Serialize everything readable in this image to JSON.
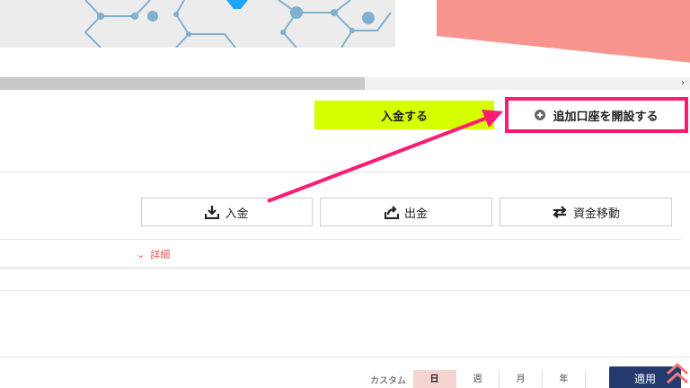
{
  "scrollbar": {
    "arrow": "›"
  },
  "actions": {
    "deposit_label": "入金する",
    "add_account_label": "追加口座を開設する"
  },
  "account_buttons": {
    "deposit": "入金",
    "withdraw": "出金",
    "transfer": "資金移動"
  },
  "detail": {
    "chevron": "⌄",
    "label": "詳細"
  },
  "filters": {
    "custom": "カスタム",
    "tabs": [
      "日",
      "週",
      "月",
      "年"
    ],
    "active": "日",
    "apply": "適用"
  },
  "colors": {
    "deposit_button": "#d6ff00",
    "highlight": "#ff1a73",
    "apply_button": "#243a6e",
    "active_tab": "#f6d3d3",
    "detail_text": "#e05a5a"
  },
  "icons": {
    "add": "plus-circle-icon",
    "deposit": "download-icon",
    "withdraw": "upload-share-icon",
    "transfer": "swap-arrows-icon",
    "back_to_top": "double-chevron-up-icon"
  }
}
